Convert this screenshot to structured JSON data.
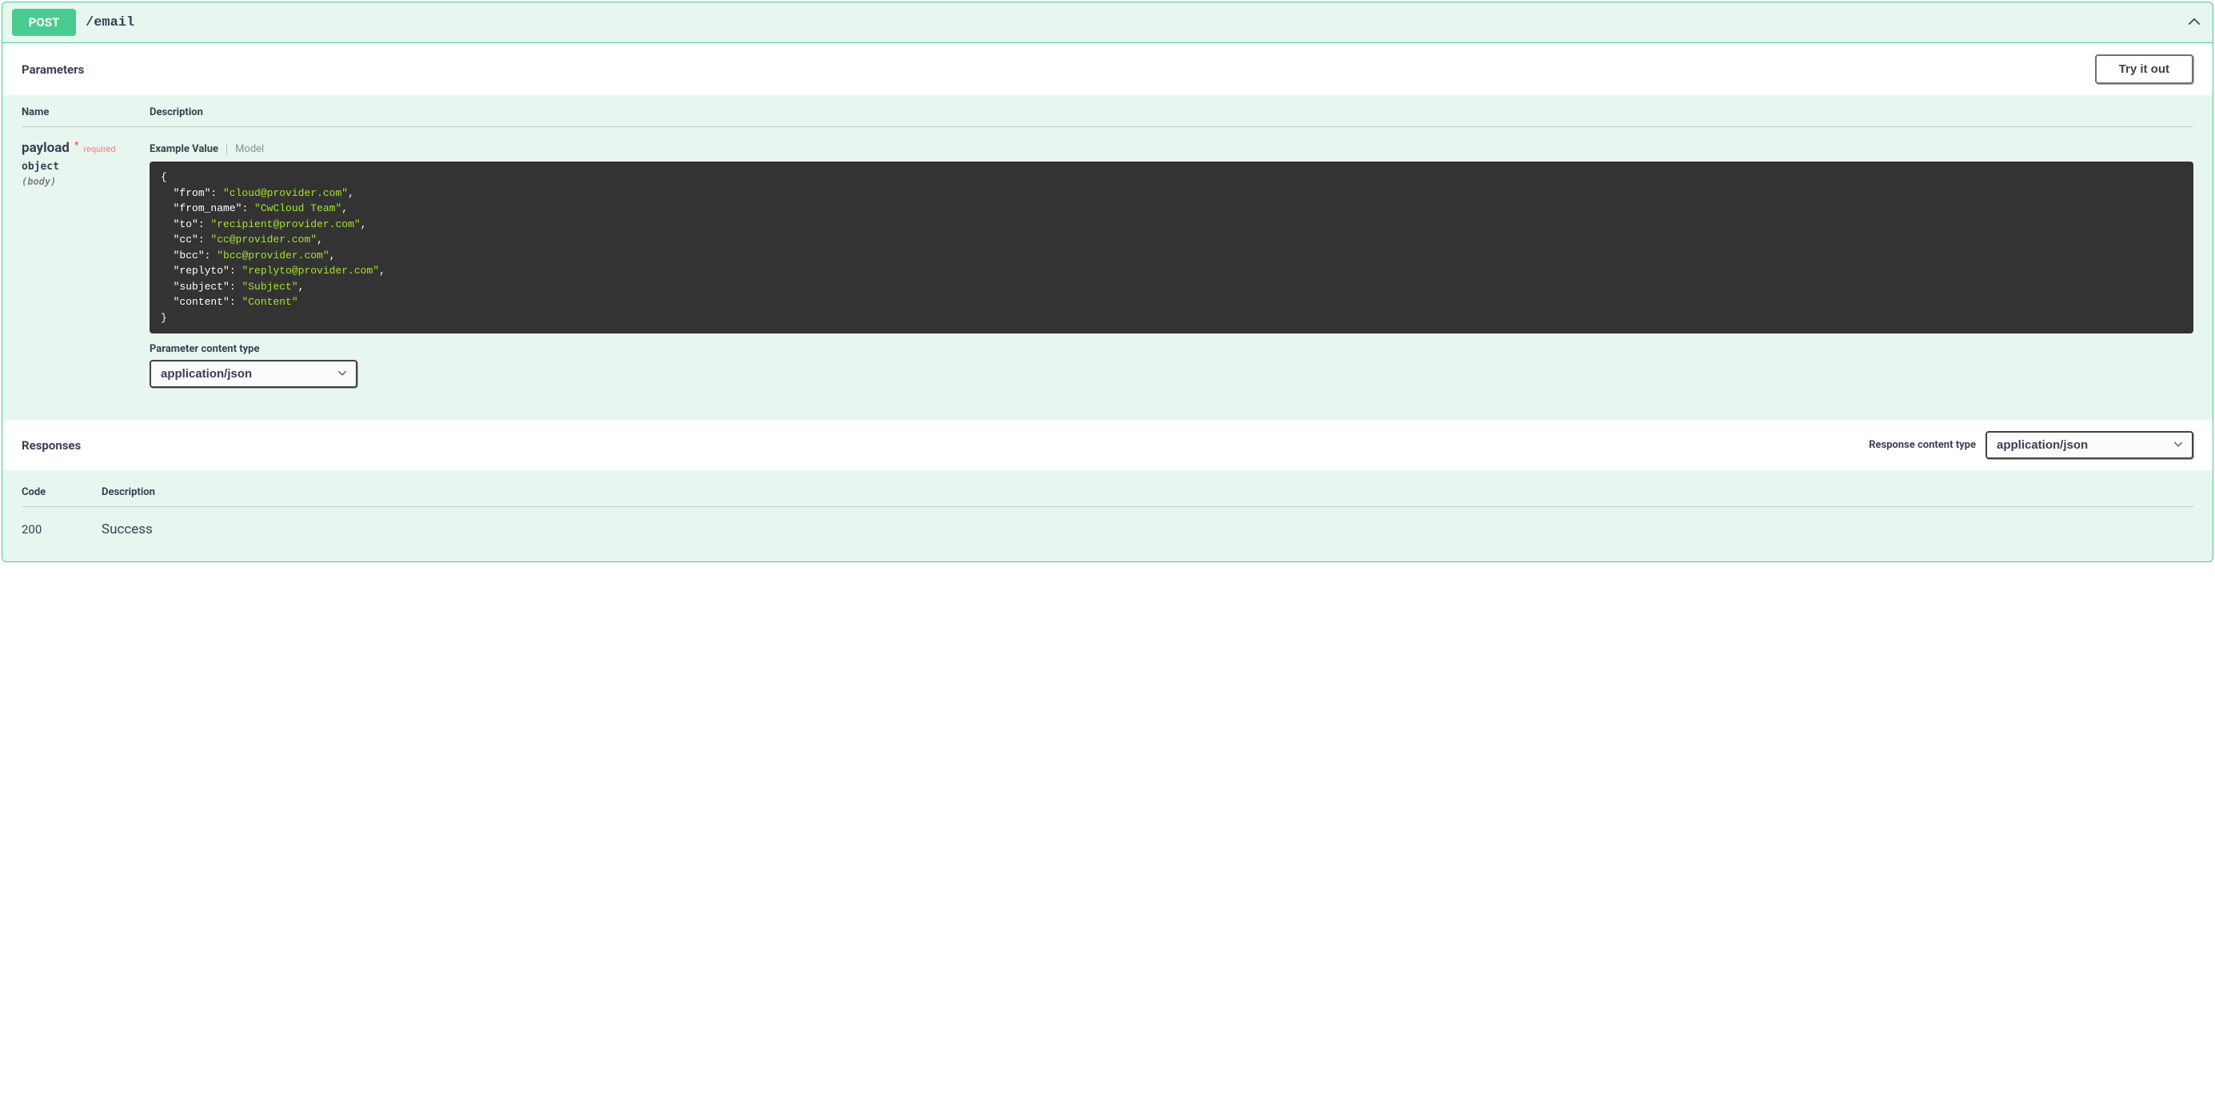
{
  "method": "POST",
  "path": "/email",
  "sections": {
    "parameters_title": "Parameters",
    "try_it_out": "Try it out",
    "name_header": "Name",
    "description_header": "Description",
    "responses_title": "Responses",
    "response_content_type_label": "Response content type",
    "code_header": "Code",
    "resp_description_header": "Description"
  },
  "parameter": {
    "name": "payload",
    "required_label": "required",
    "type": "object",
    "in": "(body)",
    "tabs": {
      "example": "Example Value",
      "model": "Model"
    },
    "example_code": "{\n  \"from\": \"cloud@provider.com\",\n  \"from_name\": \"CwCloud Team\",\n  \"to\": \"recipient@provider.com\",\n  \"cc\": \"cc@provider.com\",\n  \"bcc\": \"bcc@provider.com\",\n  \"replyto\": \"replyto@provider.com\",\n  \"subject\": \"Subject\",\n  \"content\": \"Content\"\n}",
    "content_type_label": "Parameter content type",
    "content_type_value": "application/json"
  },
  "response_content_type_value": "application/json",
  "responses": [
    {
      "code": "200",
      "description": "Success"
    }
  ]
}
